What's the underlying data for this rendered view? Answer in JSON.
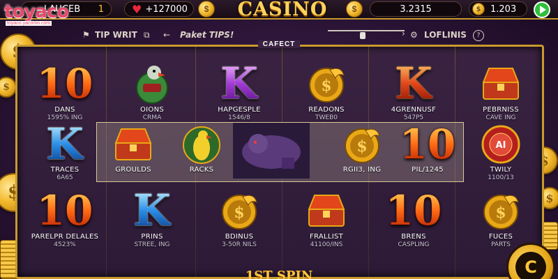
{
  "brand": {
    "logo_text": "toyaco",
    "logo_sub": "toyaco.yacomo.com"
  },
  "header": {
    "left_pill_text": "LAUCEB",
    "left_pill_suffix": "1",
    "hearts_value": "+127000",
    "title": "CASINO",
    "balance_value": "3.2315",
    "coins_value": "1.203"
  },
  "tips": {
    "tip_writ_label": "TIP WRIT",
    "paket_tips_label": "Paket TIPS!",
    "lofl_label": "LOFLINIS",
    "slider_value": 0.45
  },
  "reel_header": "CAFECT",
  "cells": [
    {
      "symbol": "ten",
      "label1": "DANS",
      "label2": "1595% ING"
    },
    {
      "symbol": "parrot-green",
      "label1": "OIONS",
      "label2": "CRMA"
    },
    {
      "symbol": "k-purple",
      "label1": "HAPGESPLE",
      "label2": "1546/8"
    },
    {
      "symbol": "gold-dragon",
      "label1": "READONS",
      "label2": "TWEB0"
    },
    {
      "symbol": "k-red",
      "label1": "4GRENNUSF",
      "label2": "547P5"
    },
    {
      "symbol": "chest",
      "label1": "PEBRNISS",
      "label2": "CAVE ING"
    },
    {
      "symbol": "k-blue",
      "label1": "TRACES",
      "label2": "6A65"
    },
    {
      "symbol": "chest",
      "label1": "GROULDS",
      "label2": ""
    },
    {
      "symbol": "parrot-yellow",
      "label1": "RACKS",
      "label2": ""
    },
    {
      "symbol": "purple-beast",
      "label1": "",
      "label2": ""
    },
    {
      "symbol": "gold-dragon",
      "label1": "RGII3, ING",
      "label2": ""
    },
    {
      "symbol": "ten",
      "label1": "PIL/1245",
      "label2": ""
    },
    {
      "symbol": "red-chip",
      "label1": "TWILY",
      "label2": "1100/13"
    },
    {
      "symbol": "ten",
      "label1": "PARELPR DELALES",
      "label2": "4523%"
    },
    {
      "symbol": "k-blue",
      "label1": "PRINS",
      "label2": "STREE, ING"
    },
    {
      "symbol": "gold-dragon",
      "label1": "BDINUS",
      "label2": "3-50R NILS"
    },
    {
      "symbol": "chest",
      "label1": "FRALLIST",
      "label2": "41100/INS"
    },
    {
      "symbol": "ten",
      "label1": "BRENS",
      "label2": "CASPLING"
    },
    {
      "symbol": "gold-dragon",
      "label1": "FUCES",
      "label2": "PARTS"
    }
  ],
  "spin": {
    "label": "1ST SPIN",
    "button_glyph": "C"
  },
  "colors": {
    "gold": "#c99a2e",
    "frame_bg": "#3a2342",
    "title": "#ffd35a",
    "play_green": "#2fbf3a"
  }
}
